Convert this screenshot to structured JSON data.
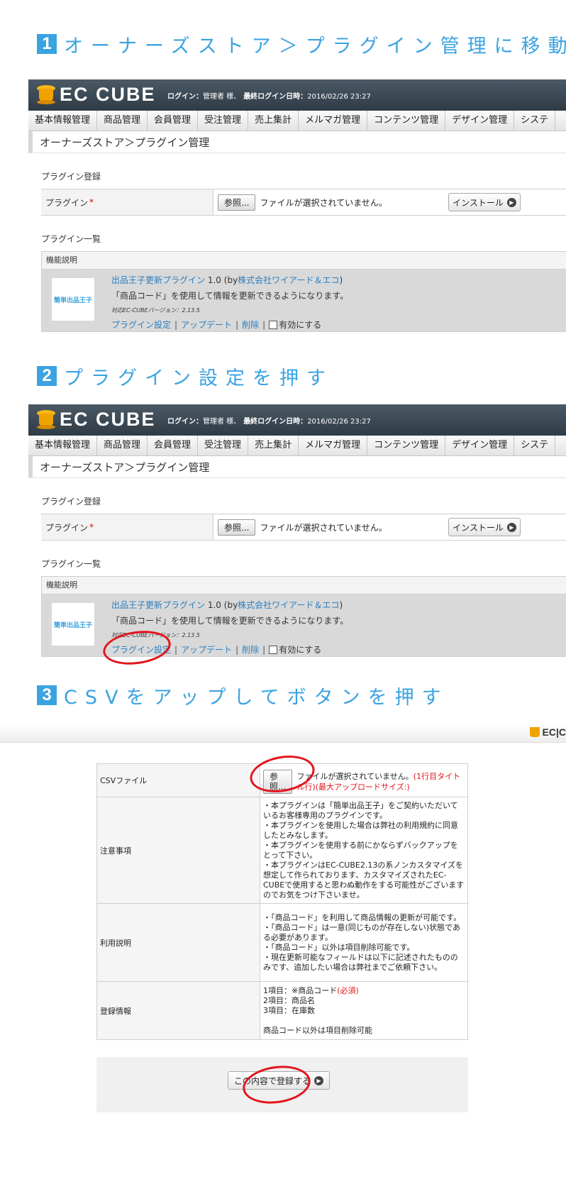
{
  "steps": [
    {
      "num": "1",
      "text": "オーナーズストア＞プラグイン管理に移動"
    },
    {
      "num": "2",
      "text": "プラグイン設定を押す"
    },
    {
      "num": "3",
      "text": "CSVをアップしてボタンを押す"
    }
  ],
  "admin": {
    "logo": "EC CUBE",
    "login_label": "ログイン：",
    "login_user": "管理者 様、",
    "last_login_label": "最終ログイン日時：",
    "last_login_time": "2016/02/26 23:27",
    "nav": [
      "基本情報管理",
      "商品管理",
      "会員管理",
      "受注管理",
      "売上集計",
      "メルマガ管理",
      "コンテンツ管理",
      "デザイン管理",
      "システ"
    ],
    "breadcrumb": "オーナーズストア＞プラグイン管理",
    "register_title": "プラグイン登録",
    "plugin_label": "プラグイン",
    "required_mark": "*",
    "browse_label": "参照...",
    "no_file": "ファイルが選択されていません。",
    "install_label": "インストール",
    "list_title": "プラグイン一覧",
    "list_header": "機能説明",
    "plugin": {
      "thumb_text": "簡単出品王子",
      "name": "出品王子更新プラグイン",
      "version": "1.0",
      "by_prefix": "(by",
      "author": "株式会社ワイアード＆エコ",
      "by_suffix": ")",
      "desc": "「商品コード」を使用して情報を更新できるようになります。",
      "ec_version": "対応EC-CUBEバージョン：2.13.5",
      "settings_link": "プラグイン設定",
      "update_link": "アップデート",
      "delete_link": "削除",
      "sep": "|",
      "enable_label": "有効にする"
    }
  },
  "csv_panel": {
    "mini_logo": "EC|C",
    "rows": {
      "csv": {
        "label": "CSVファイル",
        "browse": "参照...",
        "no_file": "ファイルが選択されていません。",
        "note": "(1行目タイトル行)(最大アップロードサイズ:)"
      },
      "caution": {
        "label": "注意事項",
        "lines": [
          "・本プラグインは「簡単出品王子」をご契約いただいているお客様専用のプラグインです。",
          "・本プラグインを使用した場合は弊社の利用規約に同意したとみなします。",
          "・本プラグインを使用する前にかならずバックアップをとって下さい。",
          "・本プラグインはEC-CUBE2.13の系ノンカスタマイズを想定して作られております、カスタマイズされたEC-CUBEで使用すると思わぬ動作をする可能性がございますのでお気をつけ下さいませ。"
        ]
      },
      "usage": {
        "label": "利用説明",
        "lines": [
          "・「商品コード」を利用して商品情報の更新が可能です。",
          "・「商品コード」は一意(同じものが存在しない)状態である必要があります。",
          "・「商品コード」以外は項目削除可能です。",
          "・現在更新可能なフィールドは以下に記述されたもののみです、追加したい場合は弊社までご依頼下さい。"
        ]
      },
      "register": {
        "label": "登録情報",
        "line1": "1項目：※商品コード",
        "line1_required": "(必須)",
        "line2": "2項目：商品名",
        "line3": "3項目：在庫数",
        "line4": "商品コード以外は項目削除可能"
      }
    },
    "submit_label": "この内容で登録する"
  }
}
